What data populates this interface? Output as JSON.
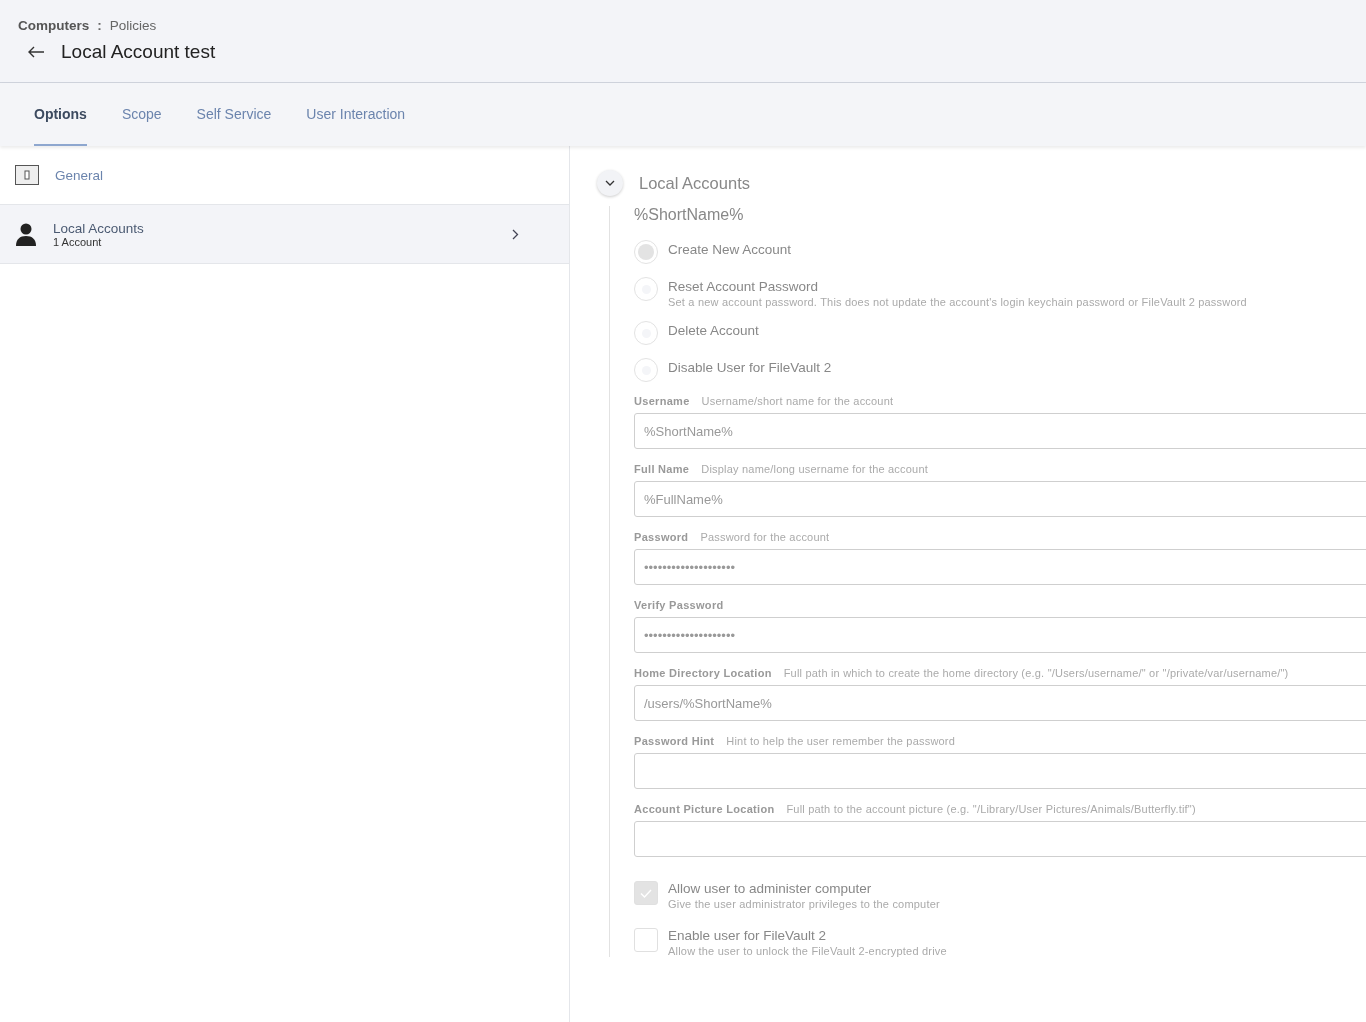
{
  "breadcrumb": {
    "parent": "Computers",
    "separator": ":",
    "current": "Policies"
  },
  "page_title": "Local Account test",
  "tabs": [
    {
      "label": "Options",
      "selected": true
    },
    {
      "label": "Scope",
      "selected": false
    },
    {
      "label": "Self Service",
      "selected": false
    },
    {
      "label": "User Interaction",
      "selected": false
    }
  ],
  "sidebar": {
    "items": [
      {
        "kind": "switch",
        "label": "General",
        "selected": false
      },
      {
        "kind": "person",
        "label": "Local Accounts",
        "sublabel": "1 Account",
        "selected": true
      }
    ]
  },
  "section": {
    "title": "Local Accounts",
    "expanded": true,
    "account_title": "%ShortName%",
    "radios": [
      {
        "label": "Create New Account",
        "selected": true
      },
      {
        "label": "Reset Account Password",
        "description": "Set a new account password. This does not update the account's login keychain password or FileVault 2 password",
        "selected": false
      },
      {
        "label": "Delete Account",
        "selected": false
      },
      {
        "label": "Disable User for FileVault 2",
        "selected": false
      }
    ],
    "fields": [
      {
        "label": "Username",
        "hint": "Username/short name for the account",
        "value": "%ShortName%"
      },
      {
        "label": "Full Name",
        "hint": "Display name/long username for the account",
        "value": "%FullName%"
      },
      {
        "label": "Password",
        "hint": "Password for the account",
        "value": "••••••••••••••••••••"
      },
      {
        "label": "Verify Password",
        "value": "••••••••••••••••••••"
      },
      {
        "label": "Home Directory Location",
        "hint": "Full path in which to create the home directory (e.g. \"/Users/username/\" or \"/private/var/username/\")",
        "value": "/users/%ShortName%"
      },
      {
        "label": "Password Hint",
        "hint": "Hint to help the user remember the password"
      },
      {
        "label": "Account Picture Location",
        "hint": "Full path to the account picture (e.g. \"/Library/User Pictures/Animals/Butterfly.tif\")"
      }
    ],
    "checkboxes": [
      {
        "label": "Allow user to administer computer",
        "description": "Give the user administrator privileges to the computer",
        "checked": true
      },
      {
        "label": "Enable user for FileVault 2",
        "description": "Allow the user to unlock the FileVault 2-encrypted drive",
        "checked": false
      }
    ]
  }
}
